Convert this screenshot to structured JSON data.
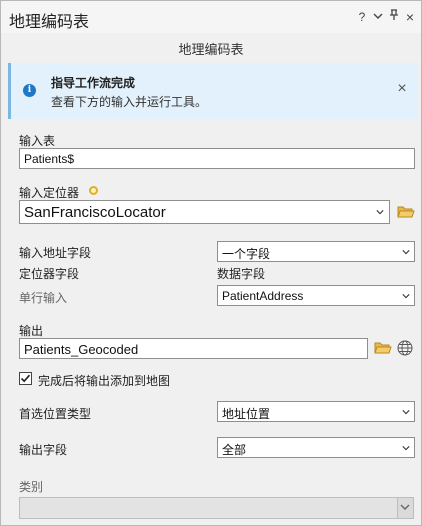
{
  "window": {
    "title": "地理编码表",
    "help": "?",
    "menu_icon": "chevron-down-icon",
    "pin": "ᛘ",
    "close": "×"
  },
  "tool_title": "地理编码表",
  "banner": {
    "title": "指导工作流完成",
    "text": "查看下方的输入并运行工具。",
    "icon": "i",
    "close": "×",
    "colors": {
      "background": "#e2f1fb",
      "icon": "#1f78c7"
    }
  },
  "input_table": {
    "label": "输入表",
    "value": "Patients$"
  },
  "locator": {
    "label": "输入定位器",
    "value": "SanFranciscoLocator"
  },
  "address_fields": {
    "label": "输入地址字段",
    "value": "一个字段"
  },
  "mapping": {
    "col_locator": "定位器字段",
    "col_data": "数据字段",
    "rows": [
      {
        "locator_field": "单行输入",
        "data_field": "PatientAddress"
      }
    ]
  },
  "output": {
    "label": "输出",
    "value": "Patients_Geocoded"
  },
  "add_to_map": {
    "label": "完成后将输出添加到地图",
    "checked": true
  },
  "preferred_location": {
    "label": "首选位置类型",
    "value": "地址位置"
  },
  "output_fields": {
    "label": "输出字段",
    "value": "全部"
  },
  "category": {
    "label": "类别",
    "value": ""
  }
}
